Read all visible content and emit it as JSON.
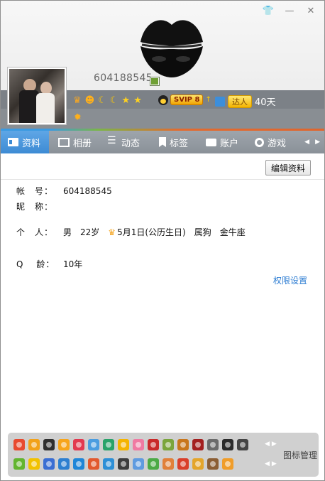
{
  "window": {
    "controls": [
      "skin-icon",
      "minimize-icon",
      "close-icon"
    ],
    "colors": {
      "tab_active": "#3d8bd4",
      "link": "#2a7bd2",
      "tabbar": "#8a9198"
    }
  },
  "profile": {
    "nickname": "604188545",
    "badges": {
      "levels": [
        "crown-icon",
        "sun-icon",
        "moon-icon",
        "moon-icon",
        "star-icon",
        "star-icon",
        "sun-icon"
      ],
      "svip_label": "SVIP 8",
      "daren_label": "达人",
      "days": "40天"
    }
  },
  "tabs": [
    {
      "label": "资料",
      "icon": "profile-card-icon",
      "active": true
    },
    {
      "label": "相册",
      "icon": "album-icon",
      "active": false
    },
    {
      "label": "动态",
      "icon": "feed-icon",
      "active": false
    },
    {
      "label": "标签",
      "icon": "tag-icon",
      "active": false
    },
    {
      "label": "账户",
      "icon": "wallet-icon",
      "active": false
    },
    {
      "label": "游戏",
      "icon": "game-icon",
      "active": false
    }
  ],
  "content": {
    "edit_button": "编辑资料",
    "account": {
      "label": "帐　号：",
      "value": "604188545"
    },
    "nick": {
      "label": "昵　称：",
      "value": ""
    },
    "personal": {
      "label": "个　人：",
      "gender": "男",
      "age": "22岁",
      "birthday": "5月1日(公历生日)",
      "zodiac": "属狗",
      "star_sign": "金牛座"
    },
    "qage": {
      "label": "Q　 龄：",
      "value": "10年"
    },
    "permission_link": "权限设置"
  },
  "icon_panel": {
    "manage_label": "图标管理",
    "row1_colors": [
      "#e8492f",
      "#f2a21a",
      "#2f2f2f",
      "#f7a51b",
      "#e2394f",
      "#4a9de0",
      "#29a36a",
      "#f5b400",
      "#f07aa2",
      "#c92a2a",
      "#7aa53b",
      "#c8761c",
      "#a31f1f",
      "#6b6b6b",
      "#2a2a2a",
      "#444444"
    ],
    "row2_colors": [
      "#62b52f",
      "#f2c200",
      "#3a6ed3",
      "#2d7fd0",
      "#1f86d8",
      "#e2592e",
      "#2d8fd6",
      "#3d3d3d",
      "#5f9be0",
      "#4caa46",
      "#e1803a",
      "#d93f2a",
      "#e4a52a",
      "#8b5e34",
      "#f09d2a"
    ]
  }
}
